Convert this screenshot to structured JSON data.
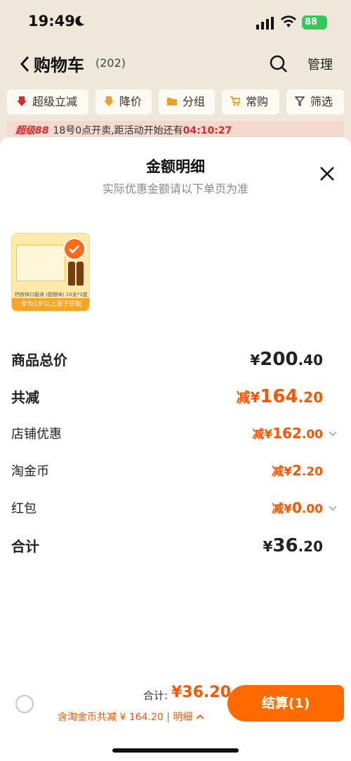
{
  "status": {
    "time": "19:49",
    "battery": "88"
  },
  "nav": {
    "title": "购物车",
    "count": "(202)",
    "manage": "管理"
  },
  "filters": [
    {
      "label": "超级立减"
    },
    {
      "label": "降价"
    },
    {
      "label": "分组"
    },
    {
      "label": "常购"
    },
    {
      "label": "筛选"
    }
  ],
  "promo": {
    "tag": "超级88",
    "text": "18号0点开卖,距活动开始还有",
    "countdown": "04:10:27"
  },
  "sheet": {
    "title": "金额明细",
    "subtitle": "实际优惠金额请以下单页为准",
    "product": {
      "strip": "专为1岁以上孩子研制",
      "caption": "钙铁锌口服液 (甜橙味) 10支*3盒"
    },
    "rows": [
      {
        "label": "商品总价",
        "prefix": "¥",
        "int": "200",
        "dec": ".40"
      },
      {
        "label": "共减",
        "prefix": "减¥",
        "int": "164",
        "dec": ".20"
      },
      {
        "label": "店铺优惠",
        "prefix": "减¥",
        "int": "162",
        "dec": ".00"
      },
      {
        "label": "淘金币",
        "prefix": "减¥",
        "int": "2",
        "dec": ".20"
      },
      {
        "label": "红包",
        "prefix": "减¥",
        "int": "0",
        "dec": ".00"
      },
      {
        "label": "合计",
        "prefix": "¥",
        "int": "36",
        "dec": ".20"
      }
    ]
  },
  "bottom": {
    "total_label": "合计:",
    "total_value": "¥36.20",
    "sub_text": "含淘金币共减 ¥ 164.20 | 明细",
    "checkout": "结算(1)"
  },
  "colors": {
    "accent": "#ff5500",
    "checkout": "#ff6a00"
  }
}
